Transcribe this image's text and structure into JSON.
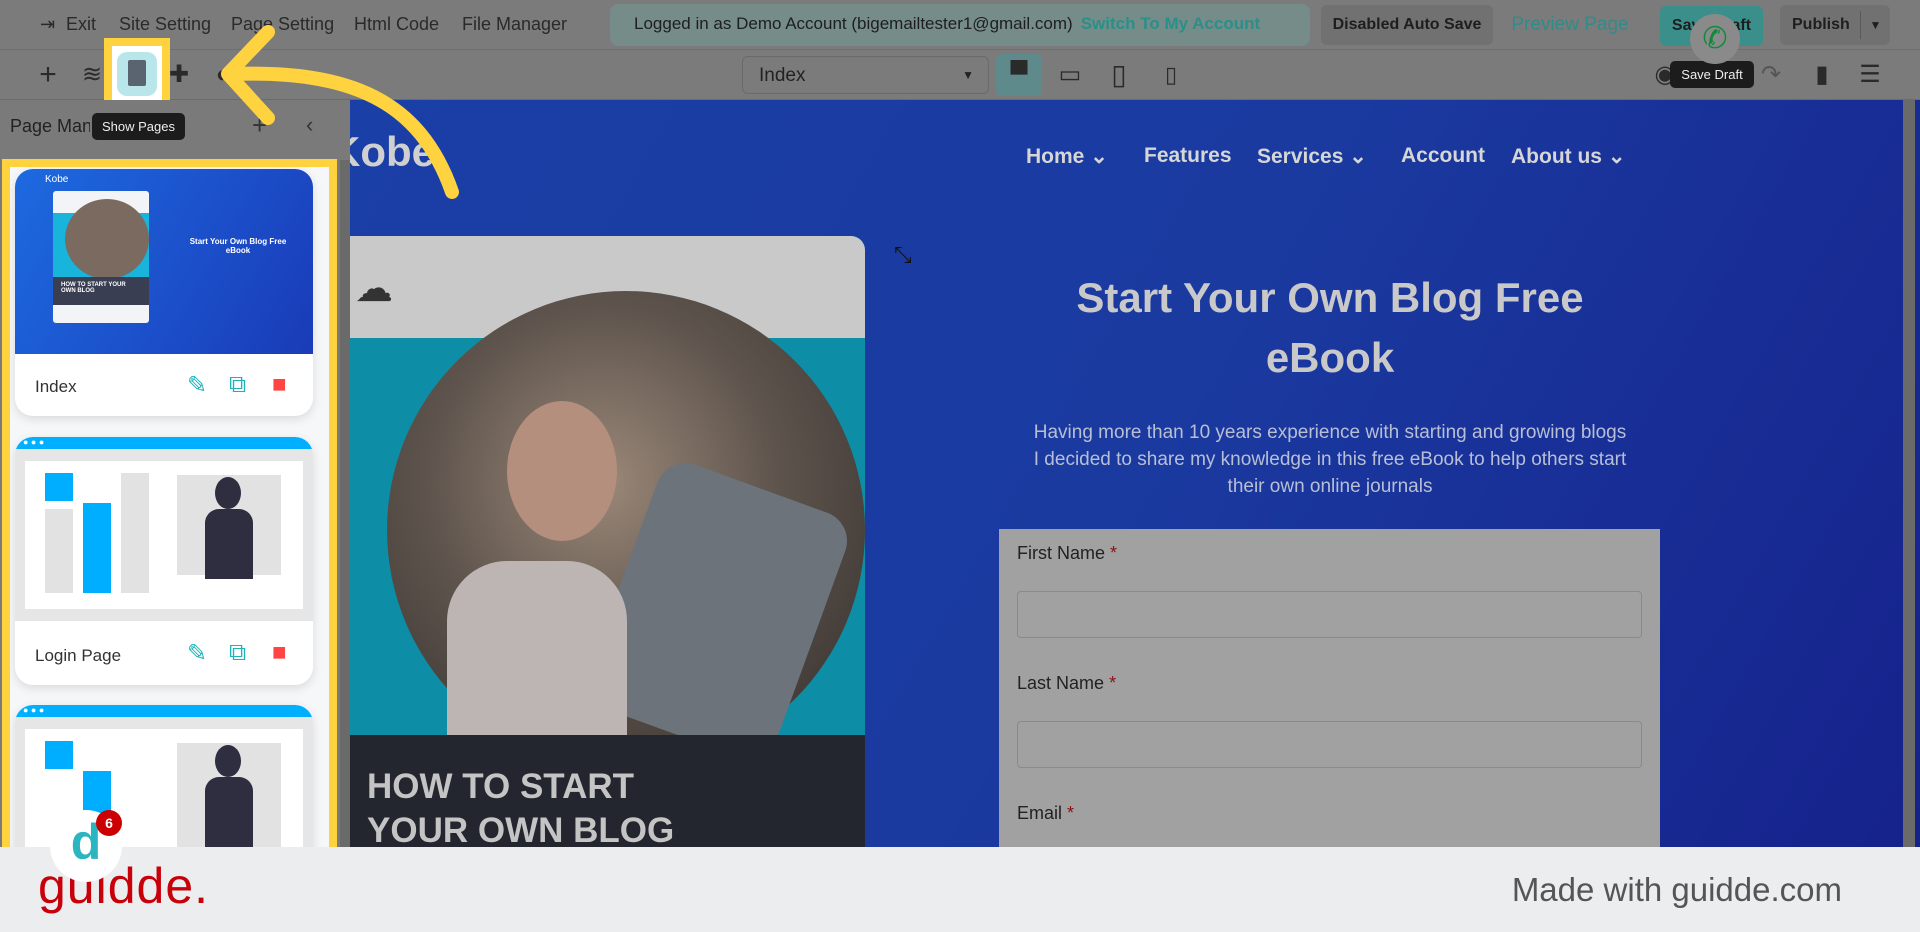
{
  "topbar": {
    "exit": "Exit",
    "site_setting": "Site Setting",
    "page_setting": "Page Setting",
    "html_code": "Html Code",
    "file_manager": "File Manager",
    "login_text": "Logged in as Demo Account (bigemailtester1@gmail.com)",
    "switch_account": "Switch To My Account",
    "auto_save": "Disabled Auto Save",
    "preview": "Preview Page",
    "save_draft": "Save Draft",
    "publish": "Publish"
  },
  "toolbar": {
    "page_select": "Index",
    "tooltip_show_pages": "Show Pages",
    "tooltip_save_draft": "Save Draft"
  },
  "sidebar": {
    "title": "Page Manager",
    "pages": [
      {
        "label": "Index"
      },
      {
        "label": "Login Page"
      },
      {
        "label": ""
      }
    ],
    "thumb": {
      "logo": "Kobe",
      "heading": "Start Your Own Blog Free eBook",
      "book": "HOW TO START YOUR OWN BLOG"
    }
  },
  "site": {
    "logo": "Kobe",
    "nav": [
      "Home",
      "Features",
      "Services",
      "Account",
      "About us"
    ],
    "heading_line1": "Start Your Own Blog Free",
    "heading_line2": "eBook",
    "paragraph": [
      "Having more than 10 years experience with starting and growing blogs",
      "I decided to share my knowledge in this free eBook to help others start",
      "their own online journals"
    ],
    "book_title_line1": "HOW TO START",
    "book_title_line2": "YOUR OWN BLOG",
    "form": {
      "first_name": "First Name",
      "last_name": "Last Name",
      "email": "Email",
      "required": "*"
    }
  },
  "widget": {
    "badge": "6"
  },
  "footer": {
    "brand": "guidde.",
    "made_with": "Made with guidde.com"
  },
  "colors": {
    "highlight": "#ffd23f",
    "brand_red": "#c8000a",
    "teal": "#2b9b96"
  }
}
